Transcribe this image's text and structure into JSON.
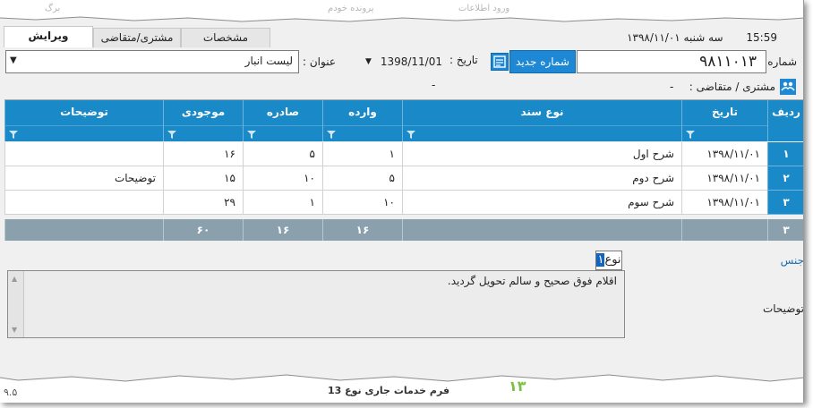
{
  "top_strip": {
    "faded_items": [
      "برگ",
      "ورود اطلاعات",
      "پرونده خودم"
    ]
  },
  "tabs": [
    {
      "label": "ویرایش",
      "active": true
    },
    {
      "label": "مشتری/متقاضی",
      "active": false
    },
    {
      "label": "مشخصات",
      "active": false
    }
  ],
  "header": {
    "time": "15:59",
    "date_text": "سه شنبه ۱۳۹۸/۱۱/۰۱"
  },
  "form": {
    "number_label": "شماره :",
    "number_value": "۹۸۱۱۰۱۳",
    "new_number_button": "شماره جدید",
    "date_label": "تاریخ :",
    "date_value": "1398/11/01",
    "title_label": "عنوان :",
    "title_value": "لیست انبار",
    "customer_label": "مشتری / متقاضی :",
    "customer_value": "-",
    "customer_extra": "-"
  },
  "grid": {
    "columns": [
      "ردیف",
      "تاریخ",
      "نوع سند",
      "وارده",
      "صادره",
      "موجودی",
      "توضیحات"
    ],
    "rows": [
      {
        "rn": "۱",
        "date": "۱۳۹۸/۱۱/۰۱",
        "type": "شرح اول",
        "in": "۱",
        "out": "۵",
        "stock": "۱۶",
        "desc": ""
      },
      {
        "rn": "۲",
        "date": "۱۳۹۸/۱۱/۰۱",
        "type": "شرح دوم",
        "in": "۵",
        "out": "۱۰",
        "stock": "۱۵",
        "desc": "توضیحات"
      },
      {
        "rn": "۳",
        "date": "۱۳۹۸/۱۱/۰۱",
        "type": "شرح سوم",
        "in": "۱۰",
        "out": "۱",
        "stock": "۲۹",
        "desc": ""
      }
    ],
    "footer": {
      "count": "۳",
      "in_total": "۱۶",
      "out_total": "۱۶",
      "stock_total": "۶۰"
    }
  },
  "lower": {
    "type_chip": "نوع",
    "type_chip_selected": "۱",
    "gender_label": "جنس",
    "description_label": "توضیحات",
    "description_text": "اقلام فوق صحیح و سالم تحویل گردید."
  },
  "bottom": {
    "text": "فرم خدمات جاری نوع 13",
    "icon_text": "۱۳",
    "left_text": "۹.۵"
  },
  "colors": {
    "grid_header": "#1a89c7",
    "footer_row": "#8aa0ad",
    "button_blue": "#1e88d4"
  }
}
